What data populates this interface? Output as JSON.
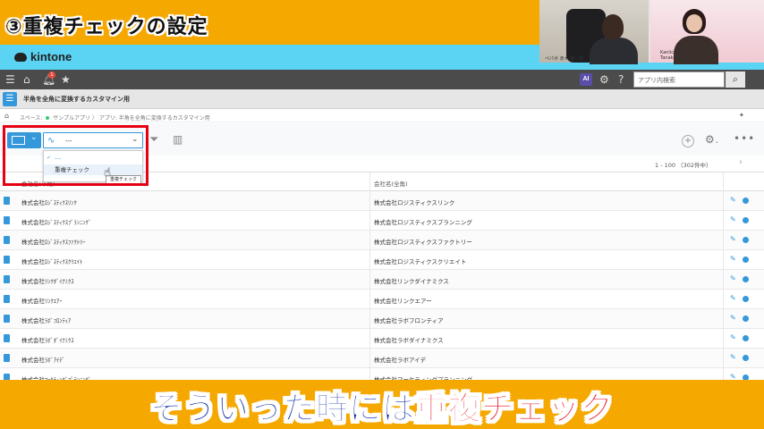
{
  "banner": {
    "title": "③重複チェックの設定"
  },
  "brand": {
    "name": "kintone"
  },
  "webcam": {
    "left_caption": "ペパボ 赤木 陽一郎",
    "right_caption": "Kanlicense\nTanaka Hiroe"
  },
  "globalbar": {
    "icons": [
      "menu-icon",
      "home-icon",
      "bell-icon",
      "star-icon",
      "ai-icon",
      "gear-icon",
      "help-icon",
      "search-icon"
    ],
    "notification_count": "1",
    "ai_label": "AI",
    "search_placeholder": "アプリ内検索"
  },
  "app": {
    "title": "半角を全角に変換するカスタマイン用",
    "breadcrumb": {
      "space_label": "スペース:",
      "space_name": "サンプルアプリ",
      "separator": "〉",
      "app_label": "アプリ: 半角を全角に変換するカスタマイン用"
    }
  },
  "toolbar": {
    "graph_select_value": "---",
    "graph_options": [
      "---",
      "重複チェック"
    ],
    "tooltip": "重複チェック"
  },
  "pager": {
    "text": "1 - 100 （302件中）"
  },
  "table": {
    "headers": [
      "会社名(半角)",
      "会社名(全角)"
    ],
    "rows": [
      [
        "株式会社ﾛｼﾞｽﾃｨｸｽﾘﾝｸ",
        "株式会社ロジスティクスリンク"
      ],
      [
        "株式会社ﾛｼﾞｽﾃｨｸｽﾌﾟﾗﾝﾆﾝｸﾞ",
        "株式会社ロジスティクスプランニング"
      ],
      [
        "株式会社ﾛｼﾞｽﾃｨｸｽﾌｧｸﾄﾘｰ",
        "株式会社ロジスティクスファクトリー"
      ],
      [
        "株式会社ﾛｼﾞｽﾃｨｸｽｸﾘｴｲﾄ",
        "株式会社ロジスティクスクリエイト"
      ],
      [
        "株式会社ﾘﾝｸﾀﾞｲﾅﾐｸｽ",
        "株式会社リンクダイナミクス"
      ],
      [
        "株式会社ﾘﾝｸｴｱｰ",
        "株式会社リンクエアー"
      ],
      [
        "株式会社ﾗﾎﾞﾌﾛﾝﾃｨｱ",
        "株式会社ラボフロンティア"
      ],
      [
        "株式会社ﾗﾎﾞﾀﾞｲﾅﾐｸｽ",
        "株式会社ラボダイナミクス"
      ],
      [
        "株式会社ﾗﾎﾞｱｲﾃﾞ",
        "株式会社ラボアイデ"
      ],
      [
        "株式会社ﾏｰｹﾃｨﾝｸﾞﾌﾟﾗﾝﾆﾝｸﾞ",
        "株式会社マーケティングプランニング"
      ]
    ]
  },
  "subtitle": {
    "normal": "そういった時には",
    "accent": "重複チェック"
  }
}
